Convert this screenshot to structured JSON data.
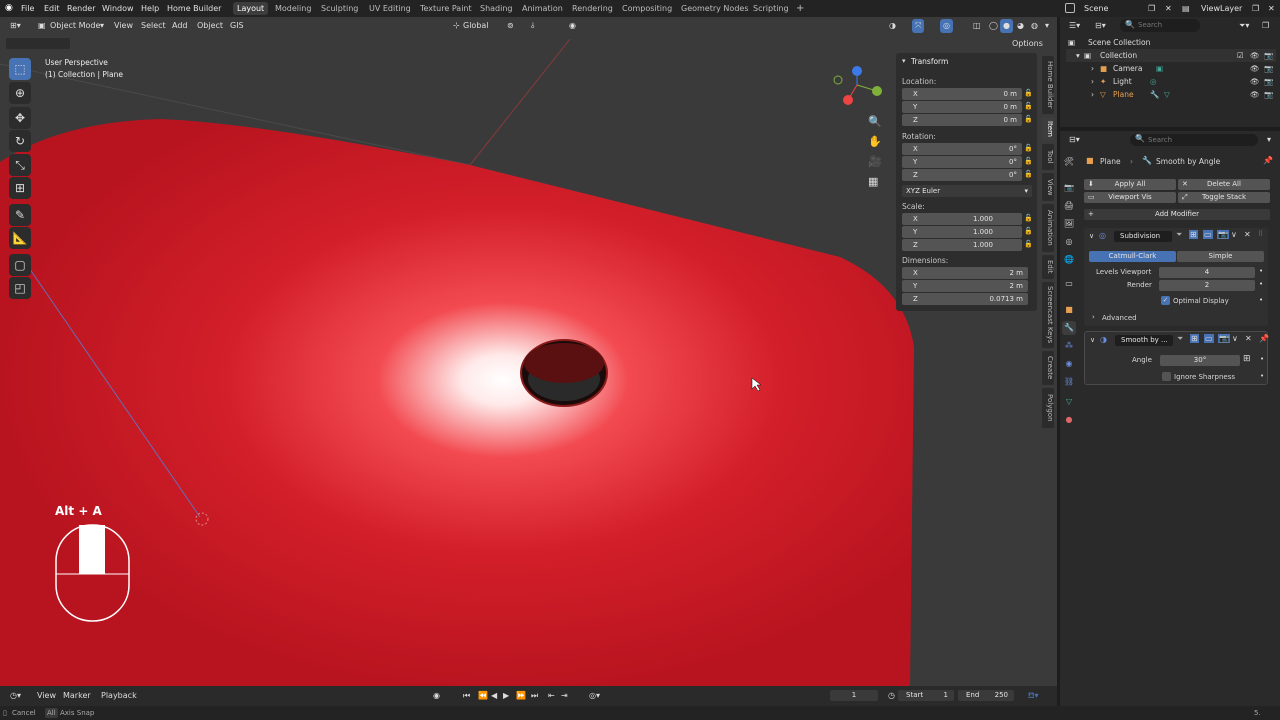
{
  "menus": [
    "File",
    "Edit",
    "Render",
    "Window",
    "Help",
    "Home Builder"
  ],
  "workspaces": [
    "Layout",
    "Modeling",
    "Sculpting",
    "UV Editing",
    "Texture Paint",
    "Shading",
    "Animation",
    "Rendering",
    "Compositing",
    "Geometry Nodes",
    "Scripting"
  ],
  "active_workspace": "Layout",
  "scene": "Scene",
  "view_layer": "ViewLayer",
  "viewport": {
    "mode": "Object Mode",
    "menus": [
      "View",
      "Select",
      "Add",
      "Object",
      "GIS"
    ],
    "transform_orientation": "Global",
    "options": "Options",
    "view_name": "User Perspective",
    "collection_info": "(1) Collection | Plane",
    "key_hint": "Alt + A"
  },
  "npanel": {
    "title": "Transform",
    "location_label": "Location:",
    "location": [
      {
        "axis": "X",
        "value": "0 m"
      },
      {
        "axis": "Y",
        "value": "0 m"
      },
      {
        "axis": "Z",
        "value": "0 m"
      }
    ],
    "rotation_label": "Rotation:",
    "rotation": [
      {
        "axis": "X",
        "value": "0°"
      },
      {
        "axis": "Y",
        "value": "0°"
      },
      {
        "axis": "Z",
        "value": "0°"
      }
    ],
    "rotation_mode": "XYZ Euler",
    "scale_label": "Scale:",
    "scale": [
      {
        "axis": "X",
        "value": "1.000"
      },
      {
        "axis": "Y",
        "value": "1.000"
      },
      {
        "axis": "Z",
        "value": "1.000"
      }
    ],
    "dimensions_label": "Dimensions:",
    "dimensions": [
      {
        "axis": "X",
        "value": "2 m"
      },
      {
        "axis": "Y",
        "value": "2 m"
      },
      {
        "axis": "Z",
        "value": "0.0713 m"
      }
    ],
    "tabs": [
      "Home Builder",
      "Item",
      "Tool",
      "View",
      "Animation",
      "Edit",
      "Screencast Keys",
      "Create",
      "Polygon"
    ]
  },
  "outliner": {
    "search_placeholder": "Search",
    "root": "Scene Collection",
    "collection": "Collection",
    "items": [
      "Camera",
      "Light",
      "Plane"
    ]
  },
  "properties": {
    "search_placeholder": "Search",
    "breadcrumb_object": "Plane",
    "breadcrumb_modifier": "Smooth by Angle",
    "apply_all": "Apply All",
    "delete_all": "Delete All",
    "viewport_vis": "Viewport Vis",
    "toggle_stack": "Toggle Stack",
    "add_modifier": "Add Modifier",
    "subdivision": {
      "name": "Subdivision",
      "type_a": "Catmull-Clark",
      "type_b": "Simple",
      "levels_viewport_label": "Levels Viewport",
      "levels_viewport": "4",
      "render_label": "Render",
      "render": "2",
      "optimal_display": "Optimal Display",
      "advanced": "Advanced"
    },
    "smooth": {
      "name": "Smooth by ...",
      "angle_label": "Angle",
      "angle": "30°",
      "ignore_sharpness": "Ignore Sharpness"
    }
  },
  "timeline": {
    "menus": [
      "View",
      "Marker",
      "Playback"
    ],
    "current_frame": "1",
    "start_label": "Start",
    "start": "1",
    "end_label": "End",
    "end": "250"
  },
  "status": {
    "cancel": "Cancel",
    "axis_snap": "Axis Snap",
    "key": "All",
    "version": "5."
  },
  "colors": {
    "accent": "#4772b3",
    "object_red": "#c8202a",
    "panel": "#2d2d2d"
  }
}
